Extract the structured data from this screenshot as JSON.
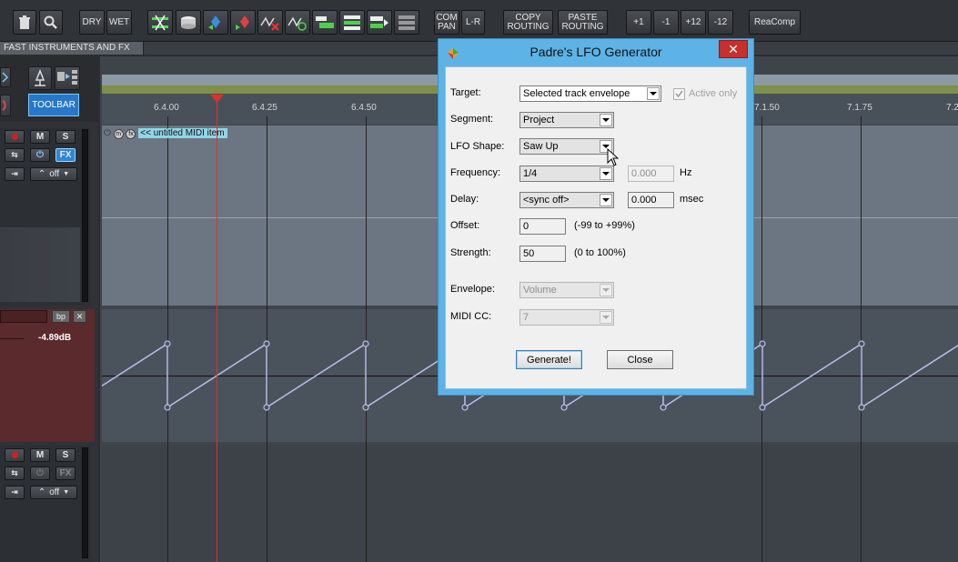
{
  "toolbar": {
    "dry": "DRY",
    "wet": "WET",
    "com": "COM",
    "pan": "PAN",
    "lr": "L-R",
    "copy_1": "COPY",
    "copy_2": "ROUTING",
    "paste_1": "PASTE",
    "paste_2": "ROUTING",
    "plus1": "+1",
    "minus1": "-1",
    "plus12": "+12",
    "minus12": "-12",
    "reacomp": "ReaComp"
  },
  "project_tab": "FAST INSTRUMENTS AND FX",
  "tcp": {
    "toolbar_label": "TOOLBAR",
    "mute": "M",
    "solo": "S",
    "fx": "FX",
    "automation_mode": "off",
    "bp": "bp",
    "close_x": "✕",
    "env_volume": "-4.89dB",
    "mute2": "M",
    "solo2": "S",
    "fx2": "FX",
    "automation_mode2": "off"
  },
  "ruler": {
    "ticks": [
      "6.4.00",
      "6.4.25",
      "6.4.50",
      "7.1.50",
      "7.1.75",
      "7.2"
    ]
  },
  "midi_item": {
    "prefix": "<< ",
    "name": "untitled MIDI item"
  },
  "envelope": {
    "color": "#b9c0ec"
  },
  "dialog": {
    "title": "Padre's LFO Generator",
    "close": "✕",
    "target_label": "Target:",
    "target_value": "Selected track envelope",
    "active_only": "Active only",
    "segment_label": "Segment:",
    "segment_value": "Project",
    "shape_label": "LFO Shape:",
    "shape_value": "Saw Up",
    "frequency_label": "Frequency:",
    "frequency_value": "1/4",
    "frequency_hz": "0.000",
    "hz_unit": "Hz",
    "delay_label": "Delay:",
    "delay_value": "<sync off>",
    "delay_ms": "0.000",
    "msec_unit": "msec",
    "offset_label": "Offset:",
    "offset_value": "0",
    "offset_range": "(-99 to +99%)",
    "strength_label": "Strength:",
    "strength_value": "50",
    "strength_range": "(0 to 100%)",
    "envelope_label": "Envelope:",
    "envelope_value": "Volume",
    "midicc_label": "MIDI CC:",
    "midicc_value": "7",
    "generate": "Generate!",
    "close_button": "Close"
  }
}
